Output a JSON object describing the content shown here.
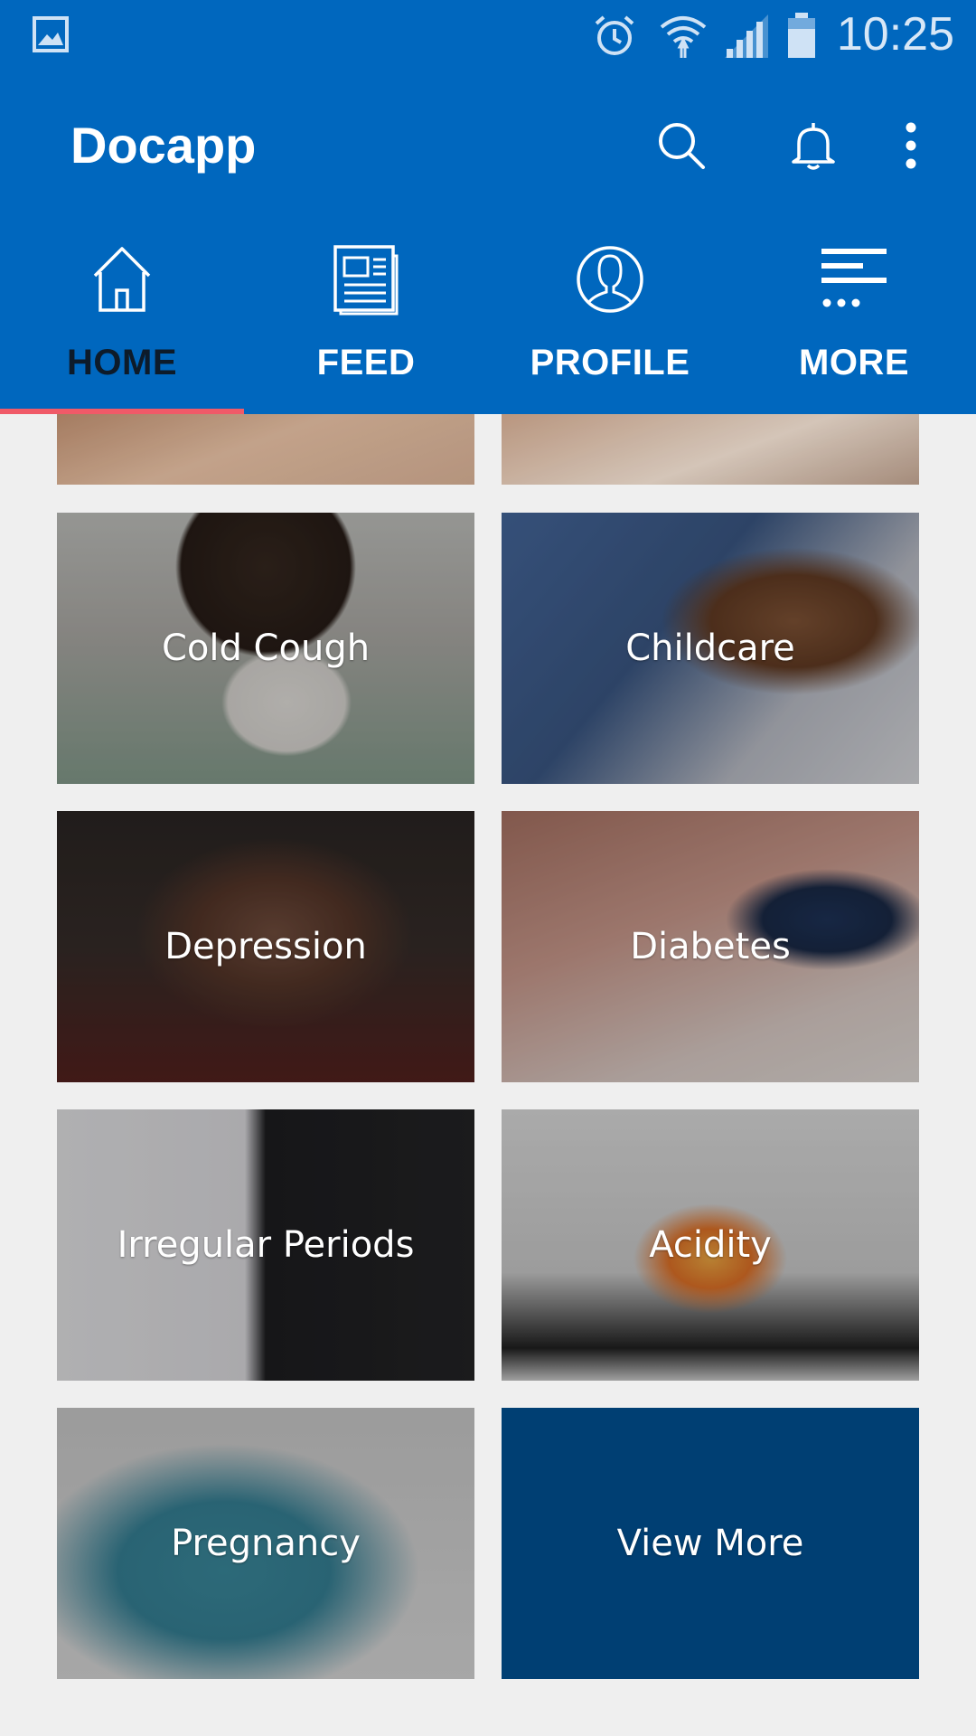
{
  "status_bar": {
    "time": "10:25",
    "icons": [
      "image-notification-icon",
      "alarm-icon",
      "wifi-icon",
      "signal-icon",
      "battery-icon"
    ]
  },
  "app_bar": {
    "title": "Docapp",
    "actions": [
      "search-icon",
      "bell-icon",
      "more-vertical-icon"
    ]
  },
  "tabs": [
    {
      "label": "HOME",
      "icon": "home-icon",
      "active": true
    },
    {
      "label": "FEED",
      "icon": "newspaper-icon",
      "active": false
    },
    {
      "label": "PROFILE",
      "icon": "user-icon",
      "active": false
    },
    {
      "label": "MORE",
      "icon": "menu-more-icon",
      "active": false
    }
  ],
  "categories": [
    {
      "label": "Cold Cough"
    },
    {
      "label": "Childcare"
    },
    {
      "label": "Depression"
    },
    {
      "label": "Diabetes"
    },
    {
      "label": "Irregular Periods"
    },
    {
      "label": "Acidity"
    },
    {
      "label": "Pregnancy"
    },
    {
      "label": "View More"
    }
  ],
  "colors": {
    "primary": "#0067be",
    "tab_indicator": "#f05a68",
    "view_more_bg": "#003f73",
    "background": "#efefef"
  }
}
